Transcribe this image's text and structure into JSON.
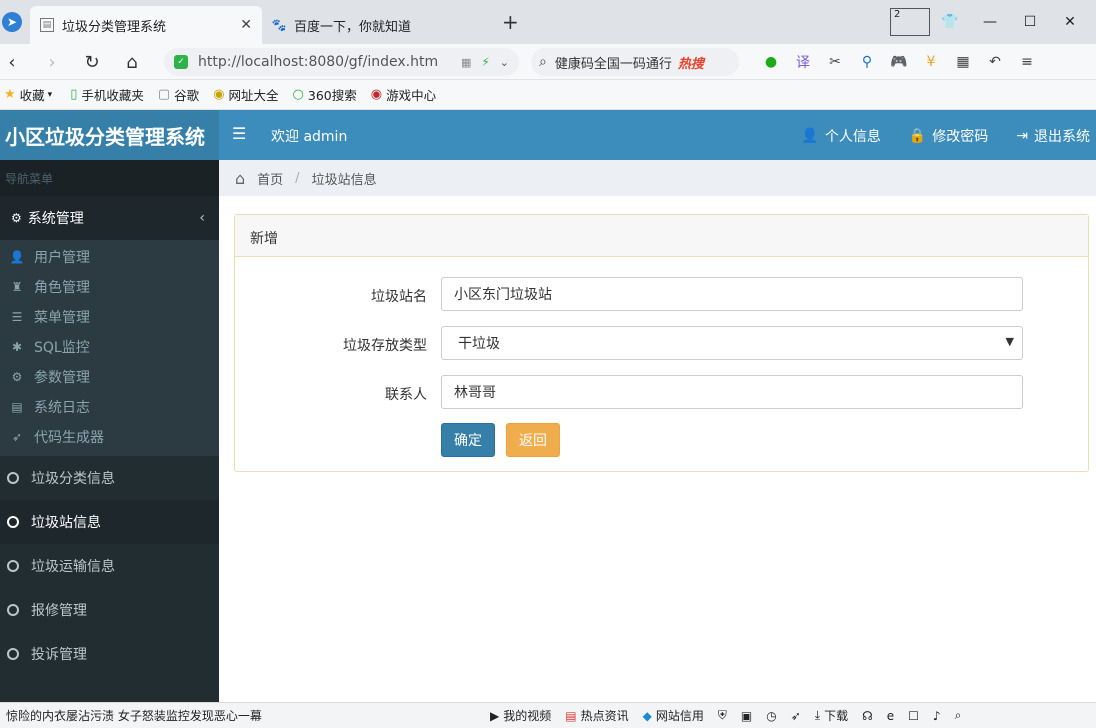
{
  "browser": {
    "tabs": [
      {
        "title": "垃圾分类管理系统",
        "active": true
      },
      {
        "title": "百度一下，你就知道",
        "active": false
      }
    ],
    "tab_count_badge": "2",
    "url": "http://localhost:8080/gf/index.htm",
    "search_text": "健康码全国一码通行",
    "search_hot_tag": "热搜",
    "bookmarks": [
      "收藏",
      "手机收藏夹",
      "谷歌",
      "网址大全",
      "360搜索",
      "游戏中心"
    ]
  },
  "header": {
    "brand": "小区垃圾分类管理系统",
    "welcome": "欢迎 admin",
    "links": [
      "个人信息",
      "修改密码",
      "退出系统"
    ]
  },
  "sidebar": {
    "nav_header": "导航菜单",
    "group_label": "系统管理",
    "sub_items": [
      "用户管理",
      "角色管理",
      "菜单管理",
      "SQL监控",
      "参数管理",
      "系统日志",
      "代码生成器"
    ],
    "main_items": [
      "垃圾分类信息",
      "垃圾站信息",
      "垃圾运输信息",
      "报修管理",
      "投诉管理"
    ],
    "active_item": "垃圾站信息"
  },
  "breadcrumb": {
    "home": "首页",
    "current": "垃圾站信息"
  },
  "form": {
    "panel_title": "新增",
    "station_name_label": "垃圾站名",
    "station_name_value": "小区东门垃圾站",
    "storage_type_label": "垃圾存放类型",
    "storage_type_value": "干垃圾",
    "contact_label": "联系人",
    "contact_value": "林哥哥",
    "confirm_label": "确定",
    "back_label": "返回"
  },
  "statusbar": {
    "news": "惊险的内衣屡沾污渍 女子怒装监控发现恶心一幕",
    "items": [
      "我的视频",
      "热点资讯",
      "网站信用",
      "下载"
    ]
  },
  "colors": {
    "header": "#3c8dbc",
    "brand": "#367fa9",
    "sidebar": "#222d32",
    "confirm": "#367fa9",
    "back": "#f0ad4e"
  }
}
